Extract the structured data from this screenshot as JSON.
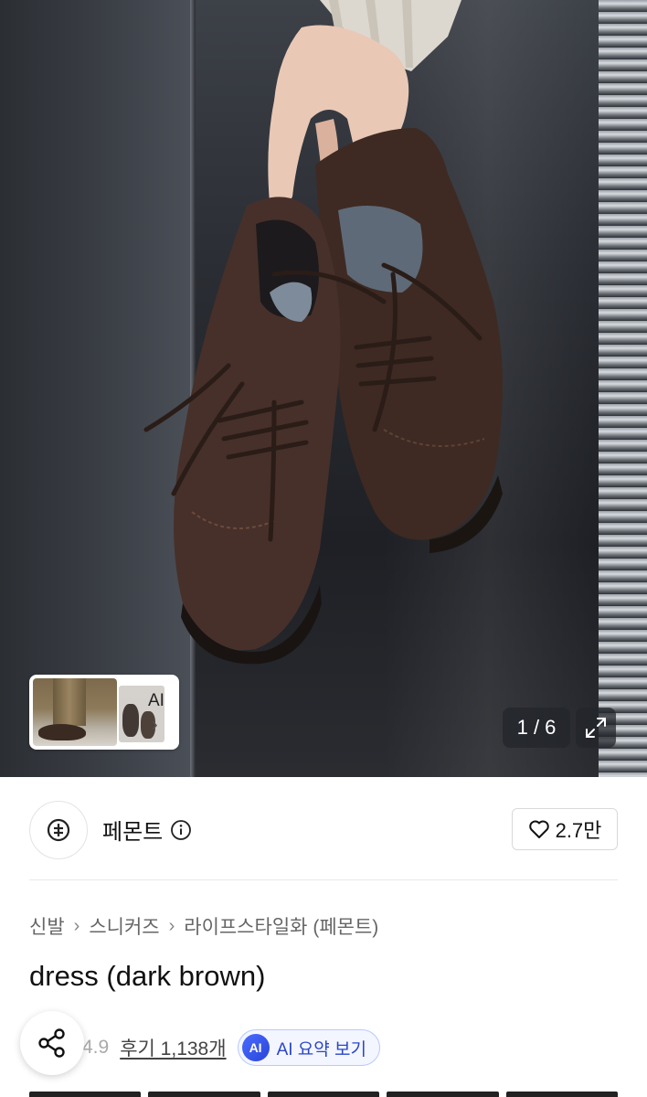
{
  "gallery": {
    "counter": "1 / 6",
    "thumb_label": "AI",
    "thumb_chevron": "›"
  },
  "brand": {
    "name": "페몬트",
    "likes": "2.7만"
  },
  "breadcrumb": [
    "신발",
    "스니커즈",
    "라이프스타일화 (페몬트)"
  ],
  "product": {
    "title": "dress (dark brown)",
    "rating": "4.9",
    "reviews": "후기 1,138개",
    "ai_summary_badge": "AI",
    "ai_summary": "AI 요약 보기"
  },
  "icons": {
    "share": "share-icon",
    "heart": "heart-icon",
    "info": "info-icon",
    "expand": "expand-icon",
    "brand_logo": "brand-logo-icon"
  }
}
